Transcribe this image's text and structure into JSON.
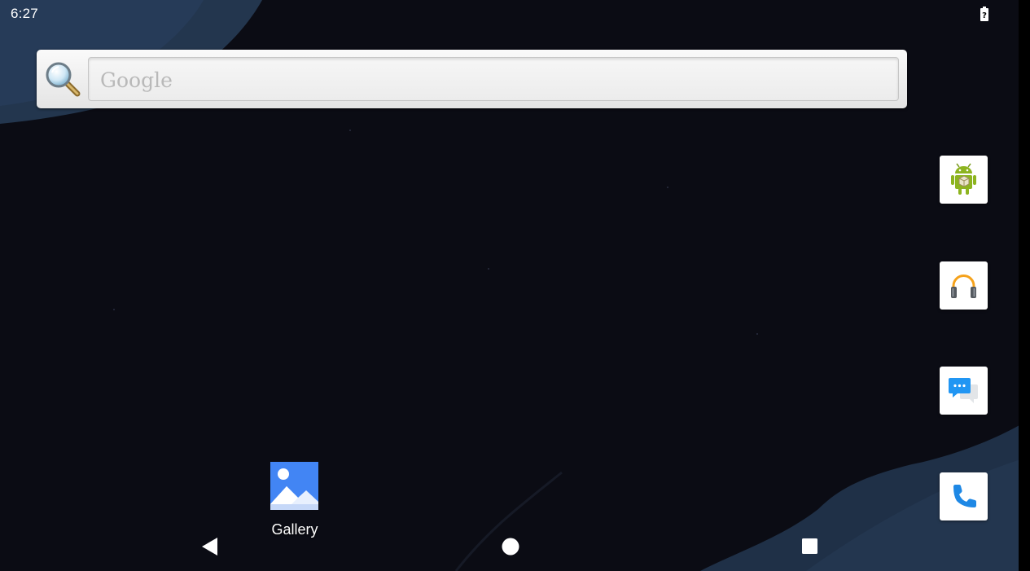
{
  "status_bar": {
    "time": "6:27",
    "battery_icon": "battery-unknown-icon"
  },
  "search_widget": {
    "placeholder": "Google",
    "icon": "search-icon"
  },
  "dock": {
    "items": [
      {
        "name": "api-demos-app",
        "icon": "android-robot-icon"
      },
      {
        "name": "music-app",
        "icon": "headphones-icon"
      },
      {
        "name": "messaging-app",
        "icon": "chat-bubbles-icon"
      },
      {
        "name": "phone-app",
        "icon": "phone-handset-icon"
      }
    ]
  },
  "home_shortcuts": {
    "gallery_label": "Gallery",
    "gallery_icon": "gallery-picture-icon"
  },
  "navigation": {
    "back_icon": "back-triangle-icon",
    "home_icon": "home-circle-icon",
    "recents_icon": "recents-square-icon"
  },
  "colors": {
    "wallpaper_dark": "#0b0c14",
    "wallpaper_blue": "#1f3047",
    "phone_blue": "#1e88e5",
    "gallery_blue": "#4285f4"
  }
}
